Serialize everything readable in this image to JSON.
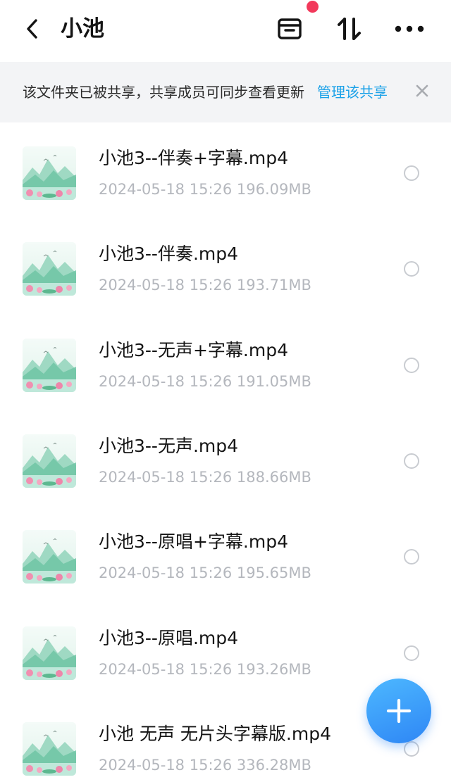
{
  "header": {
    "title": "小池",
    "icons": [
      "back-icon",
      "archive-icon",
      "sort-icon",
      "more-icon"
    ],
    "notification_dot_color": "#f2395b"
  },
  "notice": {
    "text": "该文件夹已被共享，共享成员可同步查看更新",
    "link_label": "管理该共享",
    "link_color": "#1aa1e8"
  },
  "files": [
    {
      "name": "小池3--伴奏+字幕.mp4",
      "meta": "2024-05-18   15:26   196.09MB"
    },
    {
      "name": "小池3--伴奏.mp4",
      "meta": "2024-05-18   15:26   193.71MB"
    },
    {
      "name": "小池3--无声+字幕.mp4",
      "meta": "2024-05-18   15:26   191.05MB"
    },
    {
      "name": "小池3--无声.mp4",
      "meta": "2024-05-18   15:26   188.66MB"
    },
    {
      "name": "小池3--原唱+字幕.mp4",
      "meta": "2024-05-18   15:26   195.65MB"
    },
    {
      "name": "小池3--原唱.mp4",
      "meta": "2024-05-18   15:26   193.26MB"
    },
    {
      "name": "小池  无声 无片头字幕版.mp4",
      "meta": "2024-05-18   15:26   336.28MB"
    }
  ],
  "fab": {
    "icon": "plus-icon",
    "color": "#3a9cf7"
  }
}
